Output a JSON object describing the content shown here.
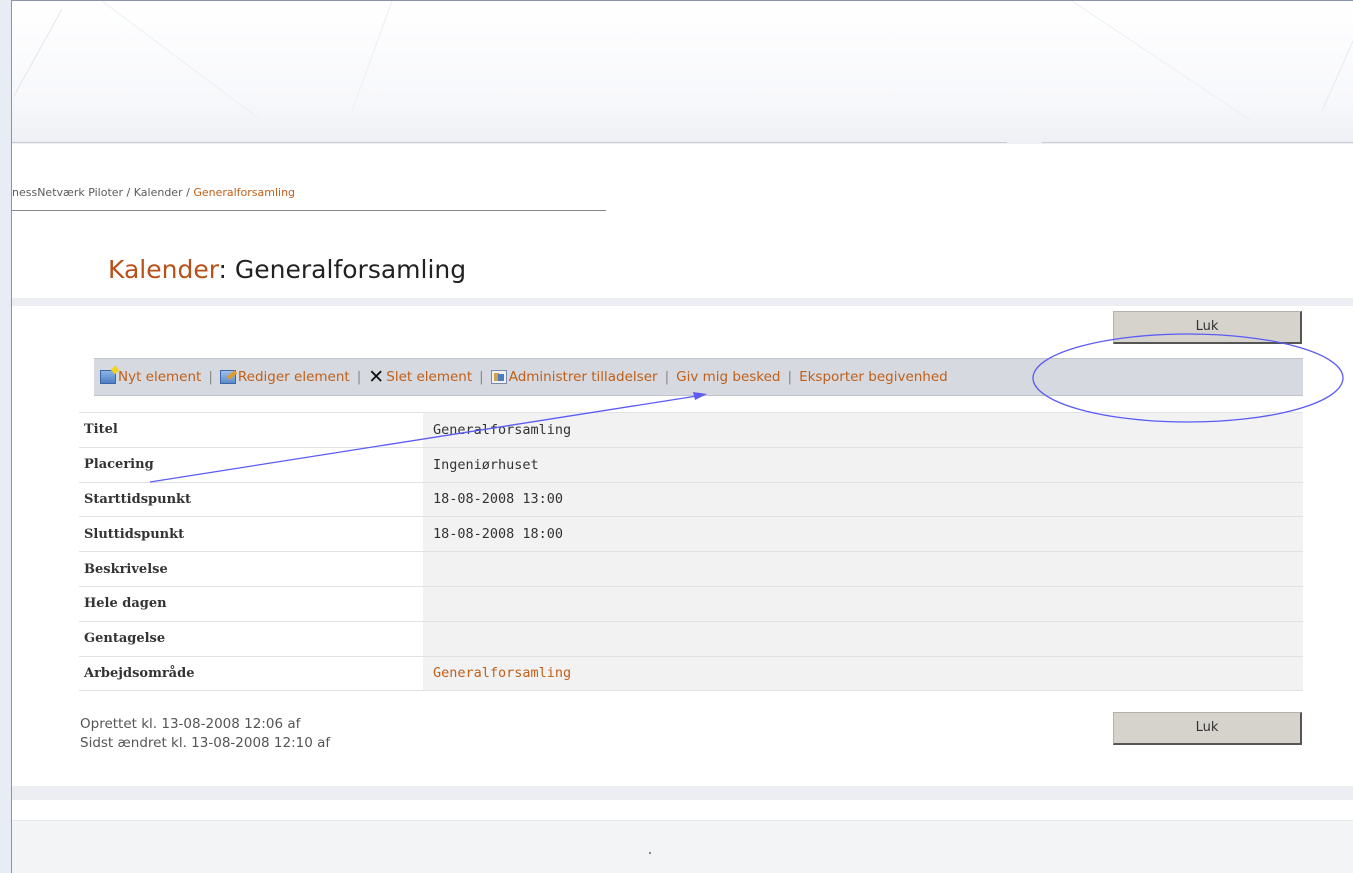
{
  "breadcrumb": {
    "items": [
      "nessNetværk Piloter",
      "Kalender",
      "Generalforsamling"
    ],
    "separator": " / "
  },
  "page_title": {
    "list_name": "Kalender",
    "separator": ": ",
    "item_name": "Generalforsamling"
  },
  "buttons": {
    "close_top": "Luk",
    "close_bottom": "Luk"
  },
  "toolbar": {
    "new_item": "Nyt element",
    "edit_item": "Rediger element",
    "delete_item": "Slet element",
    "manage_permissions": "Administrer tilladelser",
    "alert_me": "Giv mig besked",
    "export_event": "Eksporter begivenhed",
    "separator": "|"
  },
  "fields": [
    {
      "label": "Titel",
      "value": "Generalforsamling"
    },
    {
      "label": "Placering",
      "value": "Ingeniørhuset"
    },
    {
      "label": "Starttidspunkt",
      "value": "18-08-2008 13:00"
    },
    {
      "label": "Sluttidspunkt",
      "value": "18-08-2008 18:00"
    },
    {
      "label": "Beskrivelse",
      "value": ""
    },
    {
      "label": "Hele dagen",
      "value": ""
    },
    {
      "label": "Gentagelse",
      "value": ""
    },
    {
      "label": "Arbejdsområde",
      "value": "Generalforsamling"
    }
  ],
  "meta": {
    "created": "Oprettet kl. 13-08-2008 12:06  af",
    "modified": "Sidst ændret kl. 13-08-2008 12:10  af"
  },
  "colors": {
    "link": "#c0601a",
    "annotation": "#5b5bf5",
    "toolbar_bg": "#d6d9df",
    "button_bg": "#d6d3cd"
  }
}
